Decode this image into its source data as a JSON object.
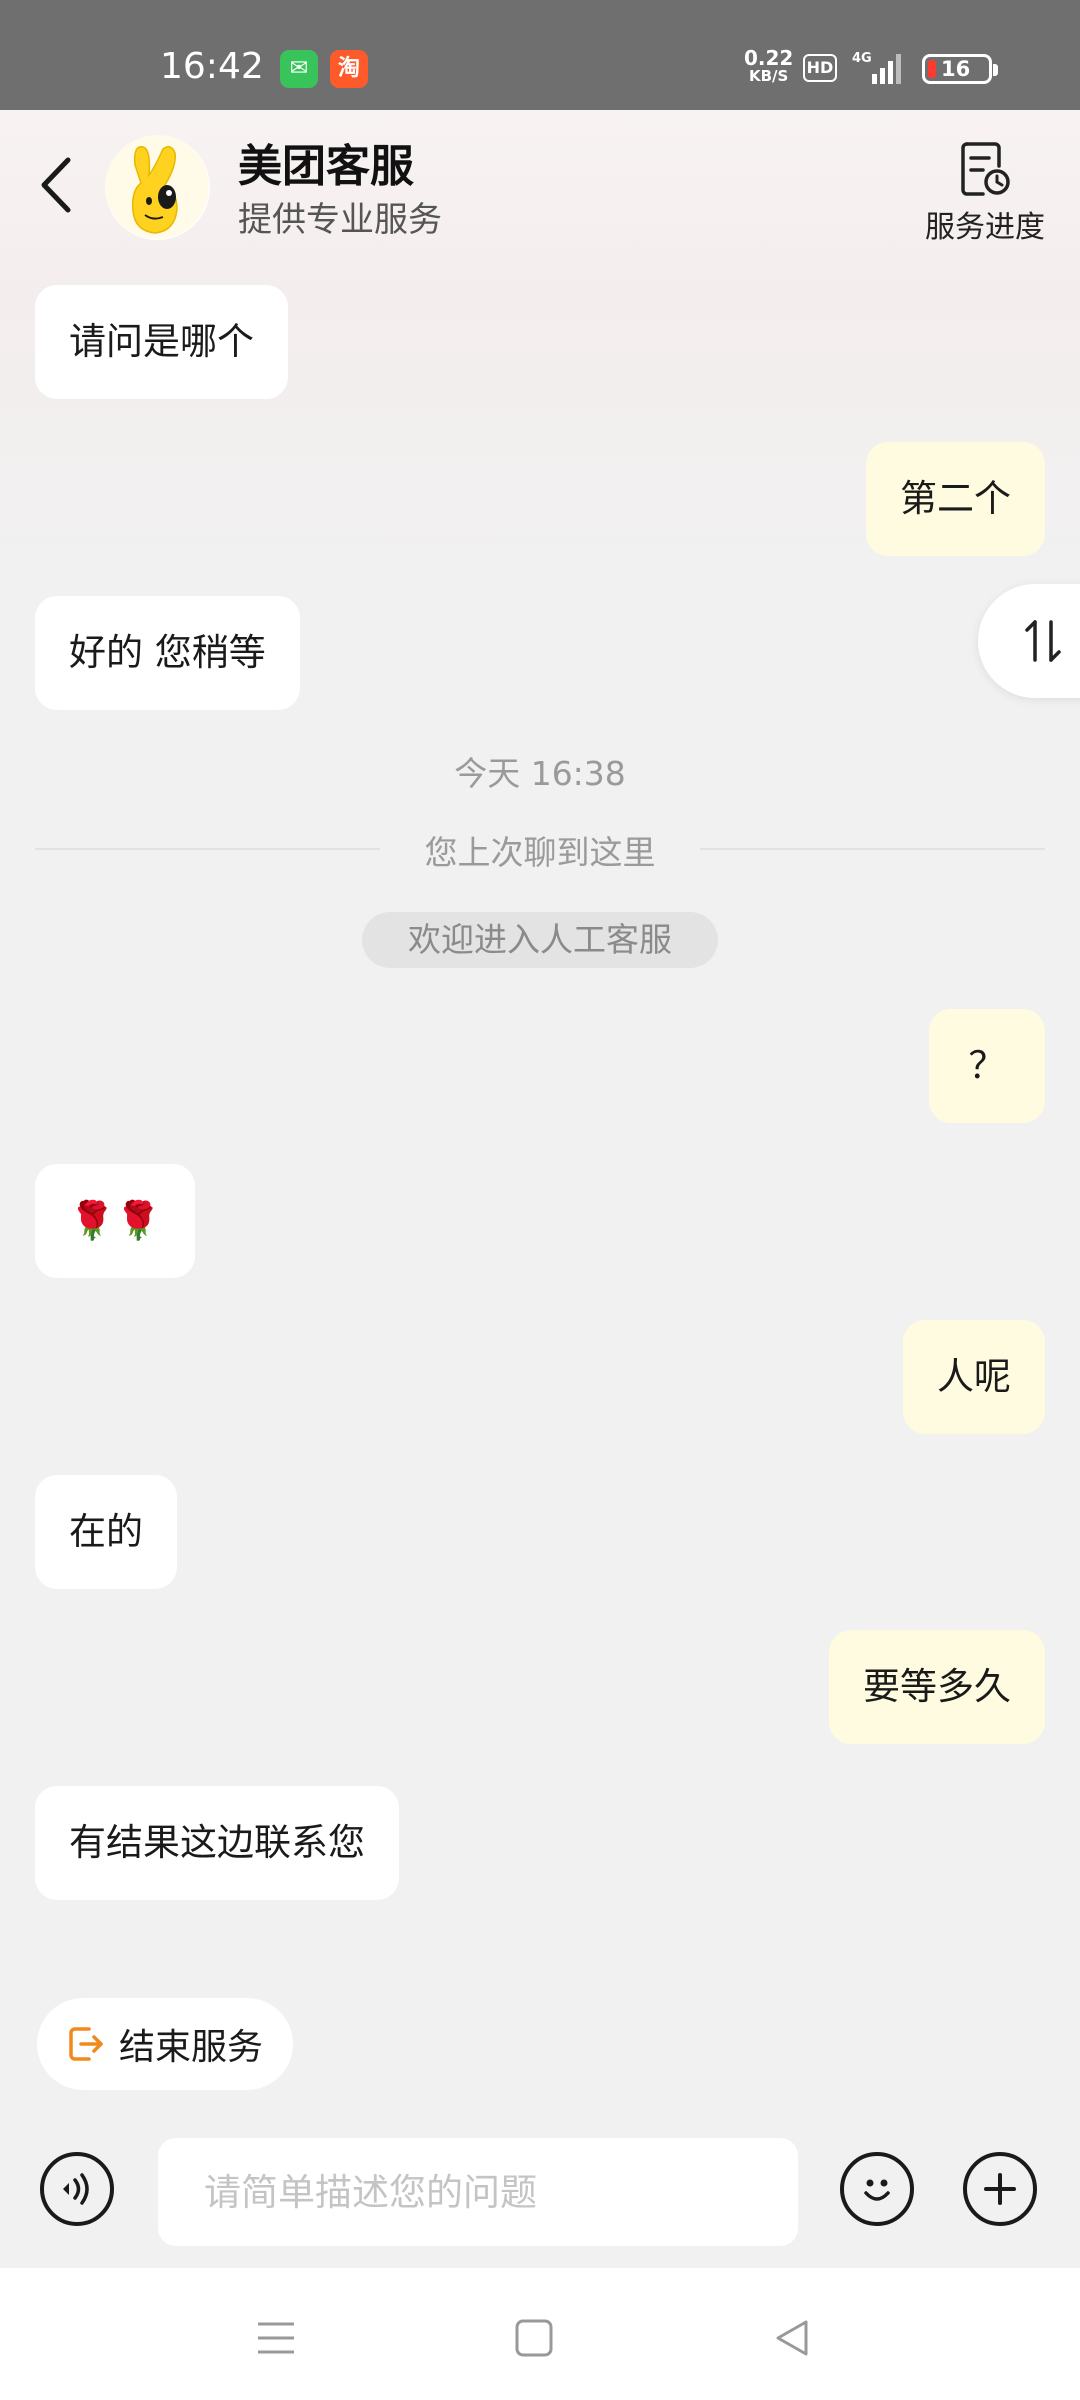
{
  "status_bar": {
    "time": "16:42",
    "net_speed_value": "0.22",
    "net_speed_unit": "KB/S",
    "hd": "HD",
    "network": "4G",
    "battery": "16"
  },
  "header": {
    "title": "美团客服",
    "subtitle": "提供专业服务",
    "progress_label": "服务进度"
  },
  "messages": [
    {
      "side": "left",
      "text": "请问是哪个"
    },
    {
      "side": "right",
      "text": "第二个"
    },
    {
      "side": "left",
      "text": "好的 您稍等"
    },
    {
      "side": "right",
      "text": "？"
    },
    {
      "side": "left",
      "text": "🌹🌹"
    },
    {
      "side": "right",
      "text": "人呢"
    },
    {
      "side": "left",
      "text": "在的"
    },
    {
      "side": "right",
      "text": "要等多久"
    },
    {
      "side": "left",
      "text": "有结果这边联系您"
    }
  ],
  "timestamp": "今天 16:38",
  "last_read_divider": "您上次聊到这里",
  "system_notice": "欢迎进入人工客服",
  "end_service_label": "结束服务",
  "input": {
    "placeholder": "请简单描述您的问题"
  },
  "icons": {
    "back": "back-arrow-icon",
    "progress": "service-progress-icon",
    "toggle": "swap-order-icon",
    "end": "exit-icon",
    "voice": "voice-icon",
    "emoji": "emoji-icon",
    "plus": "plus-icon"
  },
  "colors": {
    "accent": "#f08a1c",
    "bubble_right": "#fffbe0",
    "bubble_left": "#ffffff"
  }
}
